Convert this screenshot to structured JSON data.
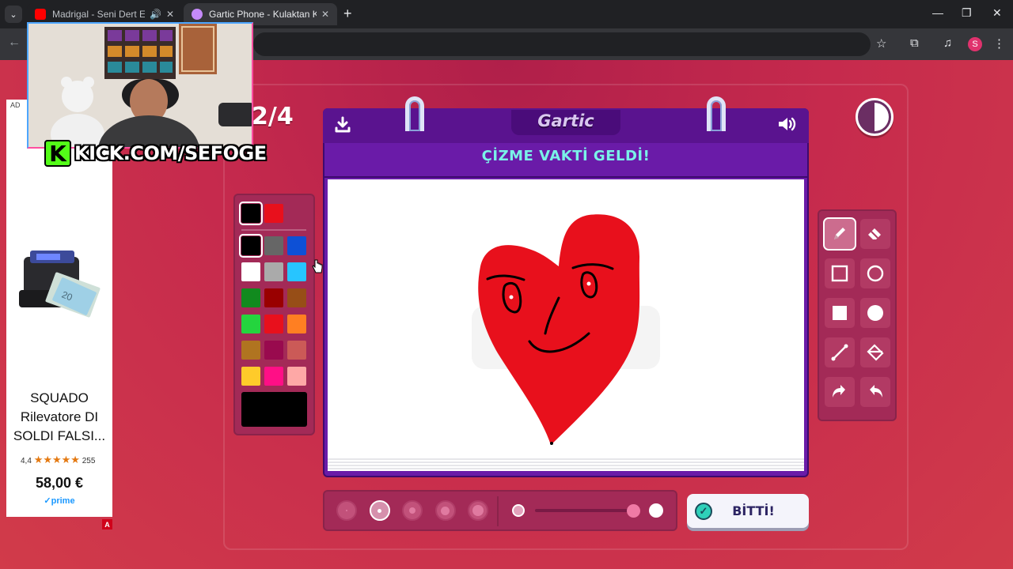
{
  "browser": {
    "tabs": [
      {
        "title": "Madrigal - Seni Dert Etmeleri",
        "favicon_color": "#ff0000",
        "audio": true
      },
      {
        "title": "Gartic Phone - Kulaktan Kulağa",
        "favicon_color": "#c58af9",
        "active": true
      }
    ],
    "new_tab": "+",
    "minimize": "—",
    "maximize": "❐",
    "close": "✕",
    "back": "←",
    "profile_initial": "S",
    "profile_color": "#e0326d"
  },
  "ad": {
    "label": "AD",
    "title": "SQUADO Rilevatore DI SOLDI FALSI...",
    "rating_value": "4,4",
    "stars": "★★★★★",
    "rating_count": "255",
    "price": "58,00 €",
    "prime": "✓prime",
    "badge": "A"
  },
  "stream": {
    "kick_logo": "K",
    "kick_url": "KICK.COM/SEFOGE"
  },
  "game": {
    "round": "2/4",
    "logo": "Gartic",
    "prompt": "ÇİZME VAKTİ GELDİ!",
    "timer_remaining_fraction": 0.5,
    "palette": {
      "recent": [
        "#000000",
        "#e8101c"
      ],
      "colors": [
        [
          "#000000",
          "#666666",
          "#0d50d6"
        ],
        [
          "#ffffff",
          "#aaaaaa",
          "#27c5ff"
        ],
        [
          "#118a1e",
          "#990000",
          "#974e17"
        ],
        [
          "#24d43e",
          "#e8101c",
          "#ff7f22"
        ],
        [
          "#b07420",
          "#990a4e",
          "#cb5a57"
        ],
        [
          "#fecb2a",
          "#ff0f86",
          "#fea8a6"
        ]
      ],
      "selected": "#000000",
      "current_color": "#000000"
    },
    "tools": [
      {
        "name": "pencil-tool",
        "icon": "pencil-icon",
        "selected": true
      },
      {
        "name": "eraser-tool",
        "icon": "eraser-icon"
      },
      {
        "name": "rectangle-outline-tool",
        "icon": "square-outline-icon"
      },
      {
        "name": "ellipse-outline-tool",
        "icon": "circle-outline-icon"
      },
      {
        "name": "rectangle-fill-tool",
        "icon": "square-filled-icon"
      },
      {
        "name": "ellipse-fill-tool",
        "icon": "circle-filled-icon"
      },
      {
        "name": "line-tool",
        "icon": "line-icon"
      },
      {
        "name": "fill-bucket-tool",
        "icon": "bucket-icon"
      },
      {
        "name": "undo-tool",
        "icon": "undo-icon"
      },
      {
        "name": "redo-tool",
        "icon": "redo-icon"
      }
    ],
    "brush_sizes": {
      "count": 5,
      "selected_index": 1
    },
    "opacity_level": 1.0,
    "done_label": "BİTTİ!"
  }
}
